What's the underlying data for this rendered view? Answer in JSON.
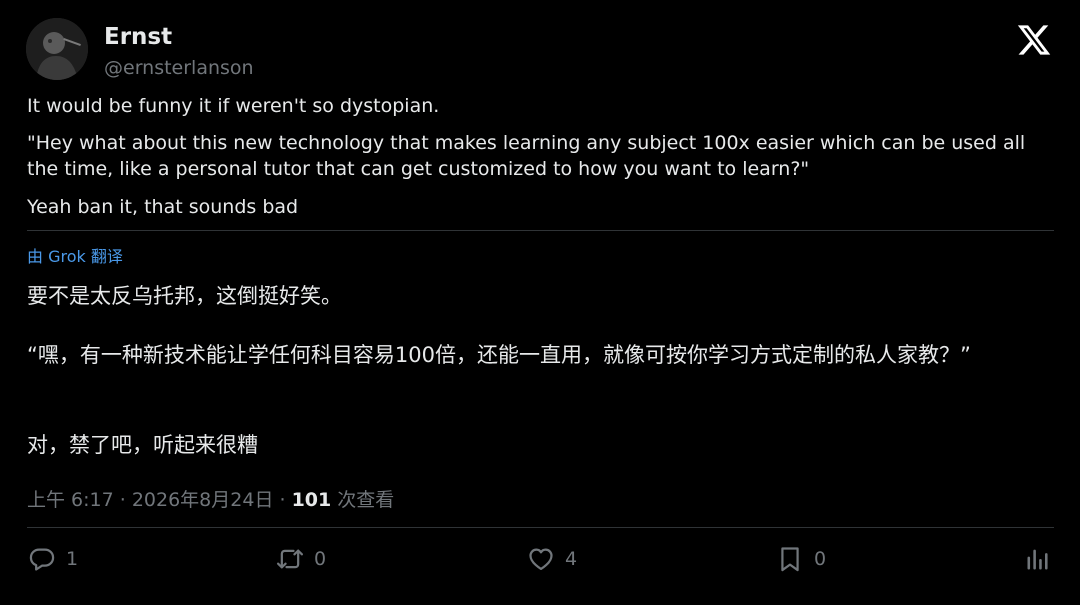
{
  "author": {
    "display_name": "Ernst",
    "handle": "@ernsterlanson"
  },
  "brand": {
    "logo_icon": "x-logo-icon",
    "accent": "#4a99e9"
  },
  "tweet": {
    "paragraphs": [
      "It would be funny it if weren't so dystopian.",
      "\"Hey what about this new technology that makes learning any subject 100x easier which can be used all the time, like a personal tutor that can get customized to how you want to learn?\"",
      "Yeah ban it, that sounds bad"
    ]
  },
  "translation": {
    "label": "由 Grok 翻译",
    "paragraphs": [
      "要不是太反乌托邦，这倒挺好笑。",
      "“嘿，有一种新技术能让学任何科目容易100倍，还能一直用，就像可按你学习方式定制的私人家教？”",
      "对，禁了吧，听起来很糟"
    ]
  },
  "meta": {
    "time_date": "上午 6:17 · 2026年8月24日 · ",
    "views_count": "101",
    "views_label": " 次查看"
  },
  "actions": {
    "replies": "1",
    "reposts": "0",
    "likes": "4",
    "bookmarks": "0",
    "reply_icon": "reply-icon",
    "repost_icon": "repost-icon",
    "like_icon": "heart-icon",
    "bookmark_icon": "bookmark-icon",
    "views_icon": "analytics-icon"
  }
}
